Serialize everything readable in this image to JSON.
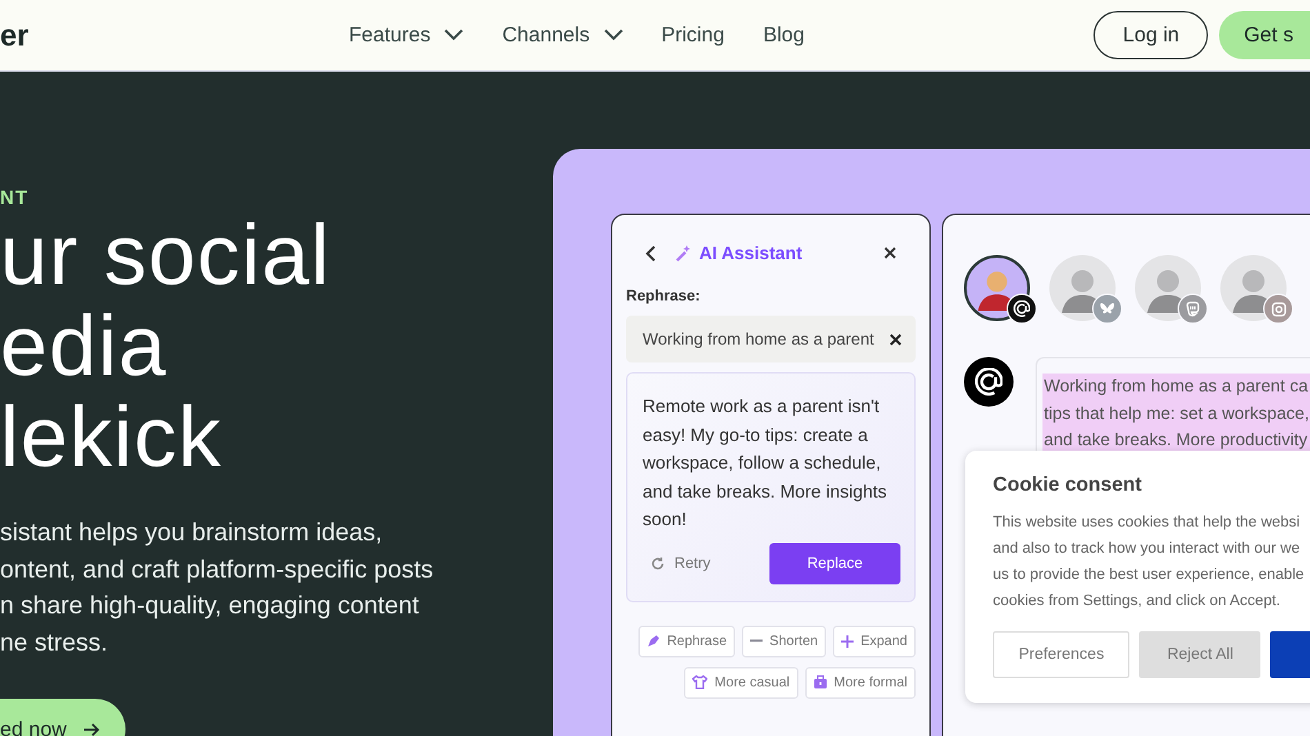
{
  "header": {
    "logo": "er",
    "nav": [
      {
        "label": "Features",
        "dropdown": true
      },
      {
        "label": "Channels",
        "dropdown": true
      },
      {
        "label": "Pricing",
        "dropdown": false
      },
      {
        "label": "Blog",
        "dropdown": false
      }
    ],
    "login": "Log in",
    "cta": "Get s"
  },
  "hero": {
    "eyebrow": "NT",
    "headline": [
      "ur social",
      "edia",
      "lekick"
    ],
    "description": [
      "sistant helps you brainstorm ideas,",
      "ontent, and craft platform-specific posts",
      "n share high-quality, engaging content",
      "ne stress."
    ],
    "cta": "ed now"
  },
  "assistant": {
    "title": "AI Assistant",
    "label": "Rephrase:",
    "input_value": "Working from home as a parent",
    "result": "Remote work as a parent isn't easy! My go-to tips: create a workspace, follow a schedule, and take breaks. More insights soon!",
    "retry": "Retry",
    "replace": "Replace",
    "actions": [
      {
        "label": "Rephrase",
        "kind": "pen"
      },
      {
        "label": "Shorten",
        "kind": "minus"
      },
      {
        "label": "Expand",
        "kind": "plus"
      },
      {
        "label": "More casual",
        "kind": "shirt"
      },
      {
        "label": "More formal",
        "kind": "briefcase"
      }
    ]
  },
  "preview": {
    "accounts": [
      {
        "kind": "threads",
        "selected": true
      },
      {
        "kind": "butterfly",
        "selected": false
      },
      {
        "kind": "mastodon",
        "selected": false
      },
      {
        "kind": "instagram",
        "selected": false
      }
    ],
    "post_lines": [
      "Working from home as a parent ca",
      "tips that help me: set a workspace,",
      "and take breaks. More productivity"
    ]
  },
  "cookie": {
    "title": "Cookie consent",
    "lines": [
      "This website uses cookies that help the websi",
      "and also to track how you interact with our we",
      "us to provide the best user experience, enable",
      "cookies from Settings, and click on Accept."
    ],
    "buttons": [
      {
        "label": "Preferences",
        "kind": "outline"
      },
      {
        "label": "Reject All",
        "kind": "secondary"
      }
    ]
  }
}
